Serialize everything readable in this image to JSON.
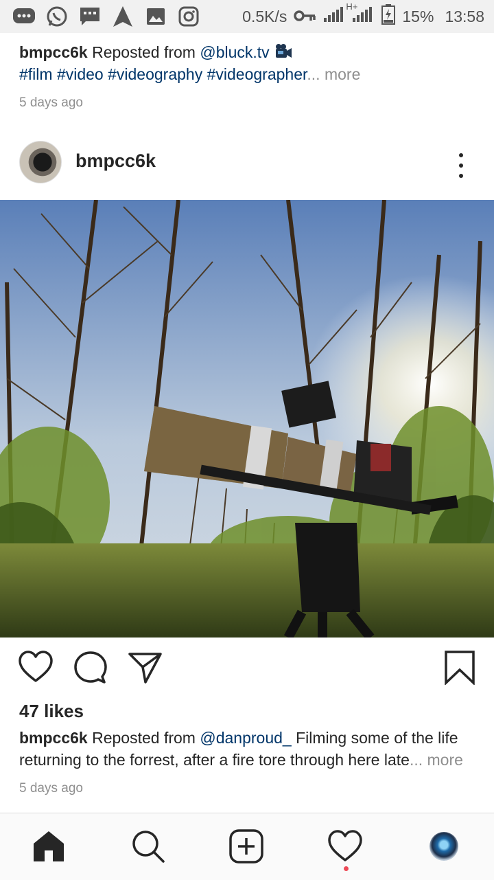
{
  "status_bar": {
    "net_speed": "0.5K/s",
    "network_label": "H+",
    "battery": "15%",
    "time": "13:58",
    "icons": [
      "message-icon",
      "whatsapp-icon",
      "sms-icon",
      "navigation-icon",
      "gallery-icon",
      "instagram-icon",
      "key-icon",
      "signal-icon",
      "battery-icon"
    ]
  },
  "prev_post": {
    "user": "bmpcc6k",
    "reposted_from": "Reposted from",
    "source": "@bluck.tv",
    "hashtags": "#film #video #videography #videographer",
    "ellipsis": "...",
    "more": "more",
    "time": "5 days ago"
  },
  "post": {
    "username": "bmpcc6k",
    "likes": "47 likes",
    "caption_user": "bmpcc6k",
    "caption_reposted": "Reposted from",
    "caption_source": "@danproud_",
    "caption_line1": "Filming some of the life",
    "caption_line2": "returning to the forrest, after a fire tore through here late",
    "ellipsis": "...",
    "more": "more",
    "time": "5 days ago"
  },
  "colors": {
    "link": "#003569",
    "muted": "#8e8e8e",
    "text": "#262626",
    "notification": "#ed4956"
  }
}
